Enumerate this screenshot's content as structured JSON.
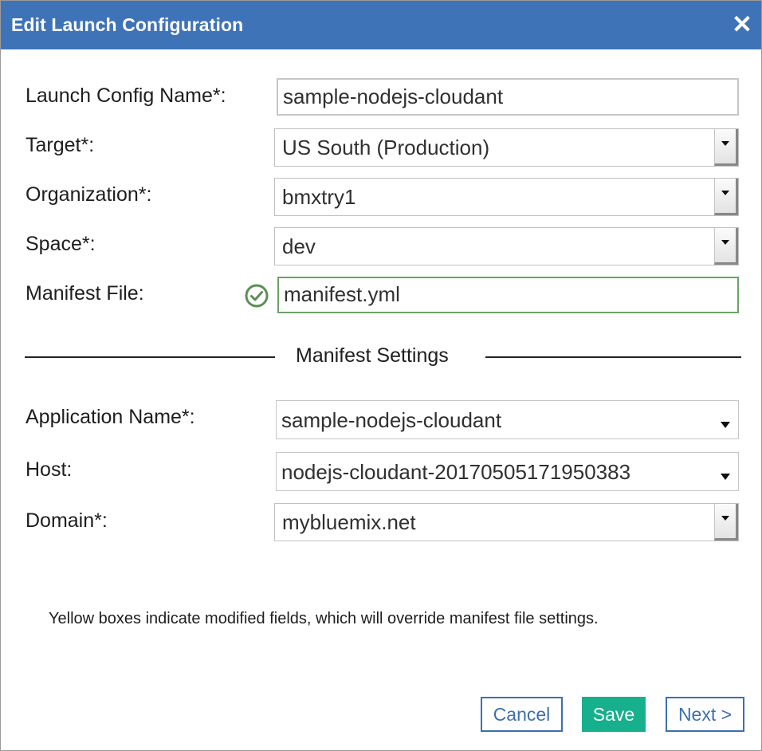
{
  "dialog": {
    "title": "Edit Launch Configuration",
    "close_label": "✕"
  },
  "form": {
    "launch_config_name": {
      "label": "Launch Config Name*:",
      "value": "sample-nodejs-cloudant"
    },
    "target": {
      "label": "Target*:",
      "value": "US South (Production)"
    },
    "organization": {
      "label": "Organization*:",
      "value": "bmxtry1"
    },
    "space": {
      "label": "Space*:",
      "value": "dev"
    },
    "manifest_file": {
      "label": "Manifest File:",
      "value": "manifest.yml",
      "status_icon": "check-circle-icon"
    }
  },
  "manifest_settings": {
    "title": "Manifest Settings",
    "application_name": {
      "label": "Application Name*:",
      "value": "sample-nodejs-cloudant"
    },
    "host": {
      "label": "Host:",
      "value": "nodejs-cloudant-20170505171950383"
    },
    "domain": {
      "label": "Domain*:",
      "value": "mybluemix.net"
    }
  },
  "note": "Yellow boxes indicate modified fields, which will override manifest file settings.",
  "buttons": {
    "cancel": "Cancel",
    "save": "Save",
    "next": "Next >"
  },
  "colors": {
    "titlebar": "#3f73b8",
    "primary_button": "#17b08c",
    "outline_button": "#3c6fb0",
    "valid_border": "#6aa268"
  }
}
